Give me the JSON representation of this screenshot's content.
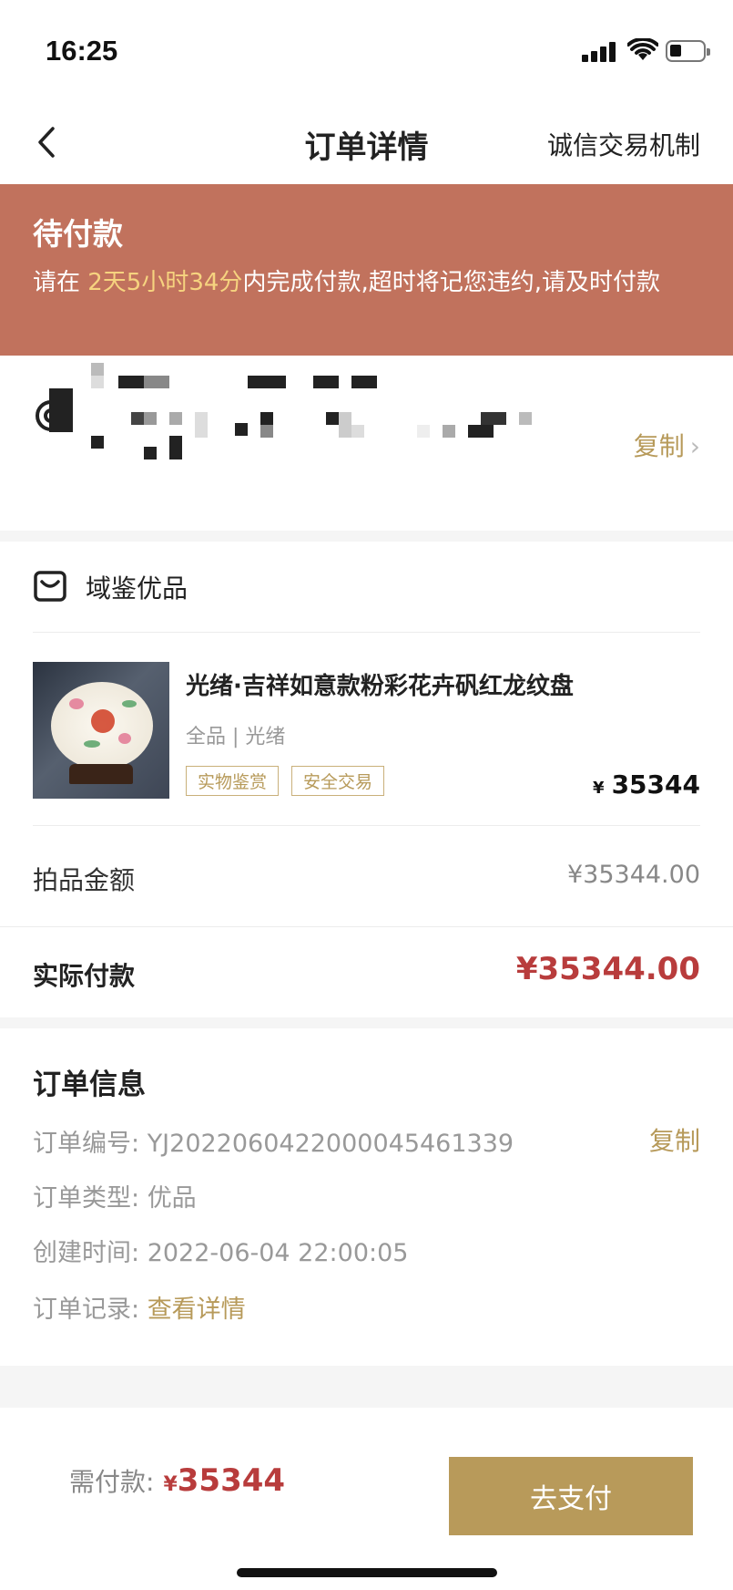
{
  "status_bar": {
    "time": "16:25"
  },
  "nav": {
    "title": "订单详情",
    "right_link": "诚信交易机制"
  },
  "banner": {
    "title": "待付款",
    "prefix": "请在 ",
    "countdown": "2天5小时34分",
    "suffix": "内完成付款,超时将记您违约,请及时付款",
    "bg_color": "#c1725d",
    "highlight_color": "#f6d37f"
  },
  "address": {
    "copy_label": "复制",
    "chevron": "›"
  },
  "shop": {
    "name": "域鉴优品",
    "icon": "shop-icon"
  },
  "product": {
    "title": "光绪·吉祥如意款粉彩花卉矾红龙纹盘",
    "meta": "全品 | 光绪",
    "tags": [
      "实物鉴赏",
      "安全交易"
    ],
    "currency": "¥",
    "price": "35344"
  },
  "amounts": {
    "auction_label": "拍品金额",
    "auction_value": "¥35344.00",
    "actual_label": "实际付款",
    "actual_value": "¥35344.00",
    "accent_color": "#b83c3c"
  },
  "order_info": {
    "heading": "订单信息",
    "number_label": "订单编号: ",
    "number_value": "YJ2022060422000045461339",
    "copy_label": "复制",
    "type_label": "订单类型: ",
    "type_value": "优品",
    "created_label": "创建时间: ",
    "created_value": "2022-06-04 22:00:05",
    "record_label": "订单记录: ",
    "record_link": "查看详情"
  },
  "bottom": {
    "need_pay_label": "需付款:",
    "currency": "¥",
    "need_pay_value": "35344",
    "pay_button": "去支付",
    "button_color": "#b89a5a"
  }
}
